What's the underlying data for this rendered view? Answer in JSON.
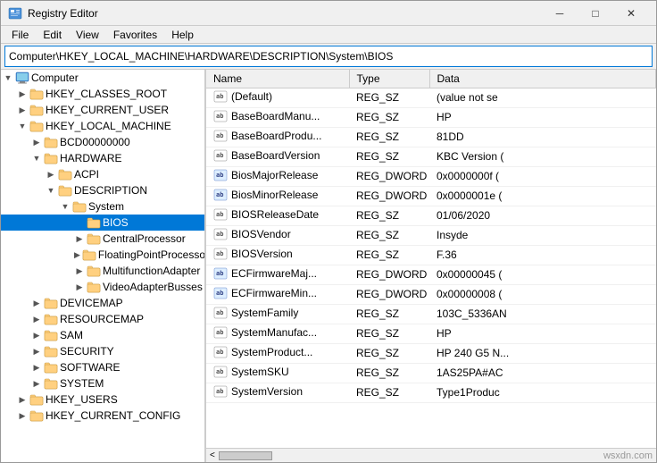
{
  "window": {
    "title": "Registry Editor",
    "controls": {
      "minimize": "─",
      "maximize": "□",
      "close": "✕"
    }
  },
  "menu": {
    "items": [
      "File",
      "Edit",
      "View",
      "Favorites",
      "Help"
    ]
  },
  "address": {
    "path": "Computer\\HKEY_LOCAL_MACHINE\\HARDWARE\\DESCRIPTION\\System\\BIOS"
  },
  "tree": {
    "items": [
      {
        "id": "computer",
        "label": "Computer",
        "indent": 0,
        "expanded": true,
        "hasChildren": true,
        "selected": false
      },
      {
        "id": "hkcr",
        "label": "HKEY_CLASSES_ROOT",
        "indent": 1,
        "expanded": false,
        "hasChildren": true,
        "selected": false
      },
      {
        "id": "hkcu",
        "label": "HKEY_CURRENT_USER",
        "indent": 1,
        "expanded": false,
        "hasChildren": true,
        "selected": false
      },
      {
        "id": "hklm",
        "label": "HKEY_LOCAL_MACHINE",
        "indent": 1,
        "expanded": true,
        "hasChildren": true,
        "selected": false
      },
      {
        "id": "bcd",
        "label": "BCD00000000",
        "indent": 2,
        "expanded": false,
        "hasChildren": true,
        "selected": false
      },
      {
        "id": "hardware",
        "label": "HARDWARE",
        "indent": 2,
        "expanded": true,
        "hasChildren": true,
        "selected": false
      },
      {
        "id": "acpi",
        "label": "ACPI",
        "indent": 3,
        "expanded": false,
        "hasChildren": true,
        "selected": false
      },
      {
        "id": "description",
        "label": "DESCRIPTION",
        "indent": 3,
        "expanded": true,
        "hasChildren": true,
        "selected": false
      },
      {
        "id": "system",
        "label": "System",
        "indent": 4,
        "expanded": true,
        "hasChildren": true,
        "selected": false
      },
      {
        "id": "bios",
        "label": "BIOS",
        "indent": 5,
        "expanded": false,
        "hasChildren": false,
        "selected": true
      },
      {
        "id": "centralprocessor",
        "label": "CentralProcessor",
        "indent": 5,
        "expanded": false,
        "hasChildren": true,
        "selected": false
      },
      {
        "id": "floatingpointprocessor",
        "label": "FloatingPointProcessor",
        "indent": 5,
        "expanded": false,
        "hasChildren": true,
        "selected": false
      },
      {
        "id": "multifunctionadapter",
        "label": "MultifunctionAdapter",
        "indent": 5,
        "expanded": false,
        "hasChildren": true,
        "selected": false
      },
      {
        "id": "videoadapterbusses",
        "label": "VideoAdapterBusses",
        "indent": 5,
        "expanded": false,
        "hasChildren": true,
        "selected": false
      },
      {
        "id": "devicemap",
        "label": "DEVICEMAP",
        "indent": 2,
        "expanded": false,
        "hasChildren": true,
        "selected": false
      },
      {
        "id": "resourcemap",
        "label": "RESOURCEMAP",
        "indent": 2,
        "expanded": false,
        "hasChildren": true,
        "selected": false
      },
      {
        "id": "sam",
        "label": "SAM",
        "indent": 2,
        "expanded": false,
        "hasChildren": true,
        "selected": false
      },
      {
        "id": "security",
        "label": "SECURITY",
        "indent": 2,
        "expanded": false,
        "hasChildren": true,
        "selected": false
      },
      {
        "id": "software",
        "label": "SOFTWARE",
        "indent": 2,
        "expanded": false,
        "hasChildren": true,
        "selected": false
      },
      {
        "id": "system2",
        "label": "SYSTEM",
        "indent": 2,
        "expanded": false,
        "hasChildren": true,
        "selected": false
      },
      {
        "id": "hku",
        "label": "HKEY_USERS",
        "indent": 1,
        "expanded": false,
        "hasChildren": true,
        "selected": false
      },
      {
        "id": "hkcc",
        "label": "HKEY_CURRENT_CONFIG",
        "indent": 1,
        "expanded": false,
        "hasChildren": true,
        "selected": false
      }
    ]
  },
  "table": {
    "columns": [
      "Name",
      "Type",
      "Data"
    ],
    "rows": [
      {
        "name": "(Default)",
        "type": "REG_SZ",
        "data": "(value not se",
        "iconType": "sz"
      },
      {
        "name": "BaseBoardManu...",
        "type": "REG_SZ",
        "data": "HP",
        "iconType": "sz"
      },
      {
        "name": "BaseBoardProdu...",
        "type": "REG_SZ",
        "data": "81DD",
        "iconType": "sz"
      },
      {
        "name": "BaseBoardVersion",
        "type": "REG_SZ",
        "data": "KBC Version (",
        "iconType": "sz"
      },
      {
        "name": "BiosMajorRelease",
        "type": "REG_DWORD",
        "data": "0x0000000f (",
        "iconType": "dword"
      },
      {
        "name": "BiosMinorRelease",
        "type": "REG_DWORD",
        "data": "0x0000001e (",
        "iconType": "dword"
      },
      {
        "name": "BIOSReleaseDate",
        "type": "REG_SZ",
        "data": "01/06/2020",
        "iconType": "sz"
      },
      {
        "name": "BIOSVendor",
        "type": "REG_SZ",
        "data": "Insyde",
        "iconType": "sz"
      },
      {
        "name": "BIOSVersion",
        "type": "REG_SZ",
        "data": "F.36",
        "iconType": "sz"
      },
      {
        "name": "ECFirmwareMaj...",
        "type": "REG_DWORD",
        "data": "0x00000045 (",
        "iconType": "dword"
      },
      {
        "name": "ECFirmwareMin...",
        "type": "REG_DWORD",
        "data": "0x00000008 (",
        "iconType": "dword"
      },
      {
        "name": "SystemFamily",
        "type": "REG_SZ",
        "data": "103C_5336AN",
        "iconType": "sz"
      },
      {
        "name": "SystemManufac...",
        "type": "REG_SZ",
        "data": "HP",
        "iconType": "sz"
      },
      {
        "name": "SystemProduct...",
        "type": "REG_SZ",
        "data": "HP 240 G5 N...",
        "iconType": "sz"
      },
      {
        "name": "SystemSKU",
        "type": "REG_SZ",
        "data": "1AS25PA#AC",
        "iconType": "sz"
      },
      {
        "name": "SystemVersion",
        "type": "REG_SZ",
        "data": "Type1Produc",
        "iconType": "sz"
      }
    ]
  },
  "statusbar": {
    "scrollLabel": "<",
    "watermark": "wsxdn.com"
  }
}
